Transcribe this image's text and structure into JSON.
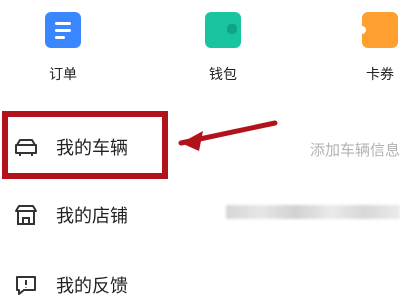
{
  "quick_actions": [
    {
      "label": "订单",
      "icon": "document-icon",
      "color": "#3a86ff"
    },
    {
      "label": "钱包",
      "icon": "wallet-icon",
      "color": "#18c5a0"
    },
    {
      "label": "卡券",
      "icon": "coupon-icon",
      "color": "#ff9f2f"
    }
  ],
  "menu": {
    "items": [
      {
        "label": "我的车辆",
        "right_text": "添加车辆信息",
        "icon": "car-icon"
      },
      {
        "label": "我的店铺",
        "right_text": "",
        "icon": "store-icon"
      },
      {
        "label": "我的反馈",
        "right_text": "",
        "icon": "feedback-icon"
      }
    ]
  },
  "annotation": {
    "box_color": "#b2131b",
    "arrow_color": "#b2131b"
  }
}
